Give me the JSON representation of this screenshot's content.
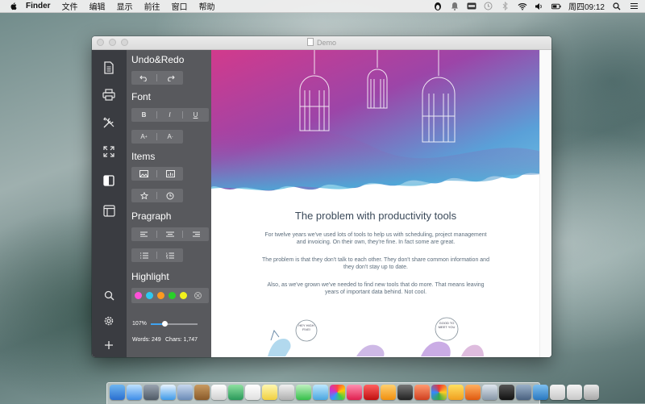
{
  "menubar": {
    "app_name": "Finder",
    "items": [
      "文件",
      "编辑",
      "显示",
      "前往",
      "窗口",
      "帮助"
    ],
    "clock": "周四09:12"
  },
  "window": {
    "title": "Demo"
  },
  "panel": {
    "undo_redo": "Undo&Redo",
    "font": "Font",
    "items": "Items",
    "paragraph": "Pragraph",
    "highlight": "Highlight",
    "bold": "B",
    "italic": "I",
    "underline": "U",
    "font_larger": "A",
    "font_smaller": "A",
    "zoom": "107%",
    "zoom_fraction": 0.3,
    "words": "Words: 249",
    "chars": "Chars: 1,747",
    "highlight_colors": [
      "#ff4fd8",
      "#2ec8f0",
      "#ff9a1f",
      "#28d028",
      "#f2f21c"
    ]
  },
  "document": {
    "headline": "The problem with productivity tools",
    "paragraphs": [
      "For twelve years we've used lots of tools to help us with scheduling, project management and invoicing. On their own, they're fine. In fact some are great.",
      "The problem is that they don't talk to each other. They don't share common information and they don't stay up to date.",
      "Also, as we've grown we've needed to find new tools that do more. That means leaving years of important data behind. Not cool."
    ],
    "bubble_left": "HEY HIGH FIVE!",
    "bubble_right": "GOOD TO MEET YOU"
  },
  "colors": {
    "rail_bg": "#3a3c41",
    "panel_bg": "#58595d",
    "accent": "#3fa3f0"
  }
}
